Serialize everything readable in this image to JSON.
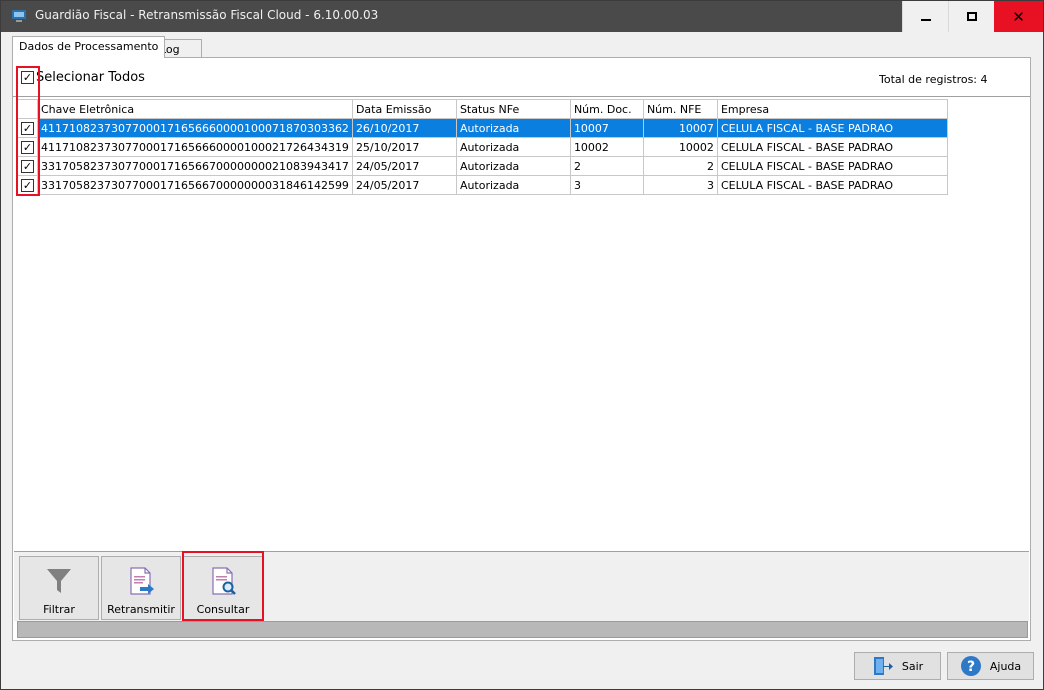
{
  "window": {
    "title": "Guardião Fiscal - Retransmissão Fiscal Cloud - 6.10.00.03"
  },
  "tabs": [
    {
      "label": "Dados de Processamento",
      "active": true
    },
    {
      "label": "Log",
      "active": false
    }
  ],
  "select_all": {
    "label": "Selecionar Todos",
    "checked": true
  },
  "total": "Total de registros: 4",
  "grid": {
    "columns": [
      "Chave Eletrônica",
      "Data Emissão",
      "Status NFe",
      "Núm. Doc.",
      "Núm. NFE",
      "Empresa"
    ],
    "rows": [
      {
        "checked": true,
        "selected": true,
        "chave": "41171082373077000171656660000100071870303362",
        "data": "26/10/2017",
        "status": "Autorizada",
        "doc": "10007",
        "nfe": "10007",
        "empresa": "CELULA FISCAL - BASE PADRAO"
      },
      {
        "checked": true,
        "selected": false,
        "chave": "41171082373077000171656660000100021726434319",
        "data": "25/10/2017",
        "status": "Autorizada",
        "doc": "10002",
        "nfe": "10002",
        "empresa": "CELULA FISCAL - BASE PADRAO"
      },
      {
        "checked": true,
        "selected": false,
        "chave": "33170582373077000171656670000000021083943417",
        "data": "24/05/2017",
        "status": "Autorizada",
        "doc": "2",
        "nfe": "2",
        "empresa": "CELULA FISCAL - BASE PADRAO"
      },
      {
        "checked": true,
        "selected": false,
        "chave": "33170582373077000171656670000000031846142599",
        "data": "24/05/2017",
        "status": "Autorizada",
        "doc": "3",
        "nfe": "3",
        "empresa": "CELULA FISCAL - BASE PADRAO"
      }
    ]
  },
  "toolbar": {
    "filtrar": "Filtrar",
    "retransmitir": "Retransmitir",
    "consultar": "Consultar"
  },
  "footer": {
    "sair": "Sair",
    "ajuda": "Ajuda"
  },
  "colors": {
    "selection": "#0a7fe0",
    "highlight": "#e81123",
    "titlebar": "#4a4a4a"
  },
  "icons": {
    "app": "app-icon",
    "filter": "funnel-icon",
    "retransmit": "document-arrow-icon",
    "consult": "document-magnifier-icon",
    "exit": "door-exit-icon",
    "help": "question-icon"
  }
}
